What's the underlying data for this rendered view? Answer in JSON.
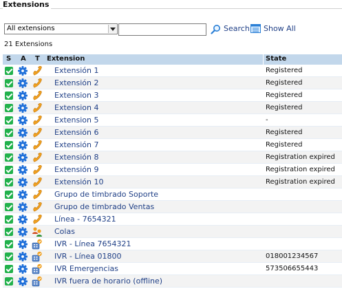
{
  "section": {
    "title": "Extensions"
  },
  "filter": {
    "selected": "All extensions",
    "search_value": "",
    "search_label": "Search",
    "showall_label": "Show All"
  },
  "count_text": "21 Extensions",
  "table": {
    "headers": {
      "s": "S",
      "a": "A",
      "t": "T",
      "extension": "Extension",
      "state": "State"
    },
    "rows": [
      {
        "name": "Extensión 1",
        "state": "Registered",
        "type": "phone"
      },
      {
        "name": "Extensión 2",
        "state": "Registered",
        "type": "phone"
      },
      {
        "name": "Extension 3",
        "state": "Registered",
        "type": "phone"
      },
      {
        "name": "Extension 4",
        "state": "Registered",
        "type": "phone"
      },
      {
        "name": "Extension 5",
        "state": "-",
        "type": "phone"
      },
      {
        "name": "Extensión 6",
        "state": "Registered",
        "type": "phone"
      },
      {
        "name": "Extensión 7",
        "state": "Registered",
        "type": "phone"
      },
      {
        "name": "Extensión 8",
        "state": "Registration expired",
        "type": "phone"
      },
      {
        "name": "Extensión 9",
        "state": "Registration expired",
        "type": "phone"
      },
      {
        "name": "Extensión 10",
        "state": "Registration expired",
        "type": "phone"
      },
      {
        "name": "Grupo de timbrado Soporte",
        "state": "",
        "type": "phone"
      },
      {
        "name": "Grupo de timbrado Ventas",
        "state": "",
        "type": "phone"
      },
      {
        "name": "Línea - 7654321",
        "state": "",
        "type": "phone"
      },
      {
        "name": "Colas",
        "state": "",
        "type": "queue"
      },
      {
        "name": "IVR - Línea 7654321",
        "state": "",
        "type": "ivr"
      },
      {
        "name": "IVR - Línea 01800",
        "state": "018001234567",
        "type": "ivr"
      },
      {
        "name": "IVR Emergencias",
        "state": "573506655443",
        "type": "ivr"
      },
      {
        "name": "IVR fuera de horario (offline)",
        "state": "",
        "type": "ivr"
      }
    ]
  },
  "colors": {
    "header_bg": "#c2d7eb",
    "link": "#1f3f86",
    "status_green": "#22b14c",
    "gear_blue": "#1e6fd9",
    "phone_orange": "#f0a020"
  }
}
